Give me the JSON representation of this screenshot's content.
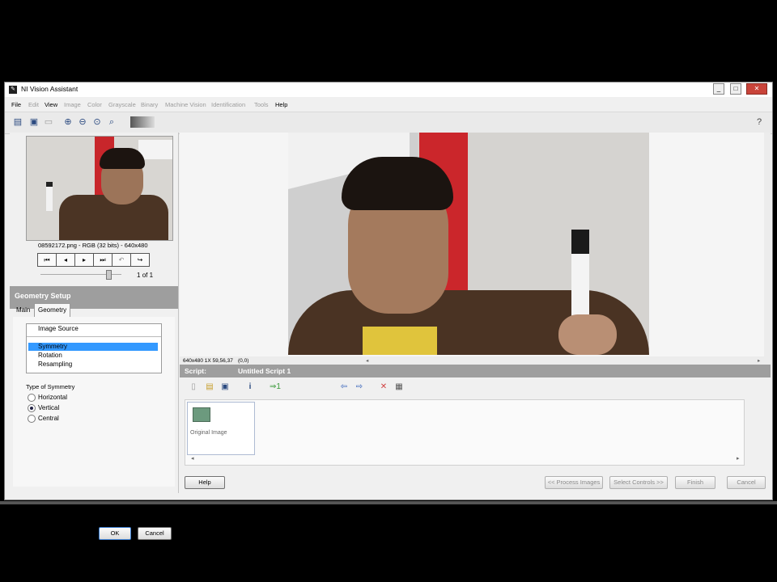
{
  "window": {
    "title": "NI Vision Assistant",
    "controls": [
      "_",
      "□",
      "✕"
    ]
  },
  "menu": [
    {
      "label": "File",
      "enabled": true
    },
    {
      "label": "Edit",
      "enabled": false
    },
    {
      "label": "View",
      "enabled": true
    },
    {
      "label": "Image",
      "enabled": false
    },
    {
      "label": "Color",
      "enabled": false
    },
    {
      "label": "Grayscale",
      "enabled": false
    },
    {
      "label": "Binary",
      "enabled": false
    },
    {
      "label": "Machine Vision",
      "enabled": false
    },
    {
      "label": "Identification",
      "enabled": false
    },
    {
      "label": "Tools",
      "enabled": false
    },
    {
      "label": "Help",
      "enabled": true
    }
  ],
  "toolbar": {
    "help_glyph": "?"
  },
  "browser": {
    "caption": "08592172.png - RGB (32 bits) - 640x480",
    "page_current": "1",
    "page_of": "of",
    "page_total": "1"
  },
  "geometry": {
    "header": "Geometry Setup",
    "tabs": {
      "main": "Main",
      "geometry": "Geometry"
    },
    "list": {
      "image_source": "Image Source",
      "items": [
        "Symmetry",
        "Rotation",
        "Resampling"
      ],
      "selected": "Symmetry"
    },
    "symmetry_type_label": "Type of Symmetry",
    "symmetry_options": [
      "Horizontal",
      "Vertical",
      "Central"
    ],
    "symmetry_selected": "Vertical",
    "ok": "OK",
    "cancel": "Cancel"
  },
  "viewer": {
    "status_info": "640x480 1X 59,56,37",
    "status_coords": "(0,0)"
  },
  "script": {
    "label": "Script:",
    "name": "Untitled Script 1",
    "step_label": "Original Image"
  },
  "bottom": {
    "help": "Help",
    "process": "<< Process Images",
    "select_controls": "Select Controls >>",
    "finish": "Finish",
    "cancel": "Cancel"
  },
  "colors": {
    "selection": "#3399ff",
    "panel_header": "#9e9e9e",
    "close_button": "#c9443a"
  }
}
